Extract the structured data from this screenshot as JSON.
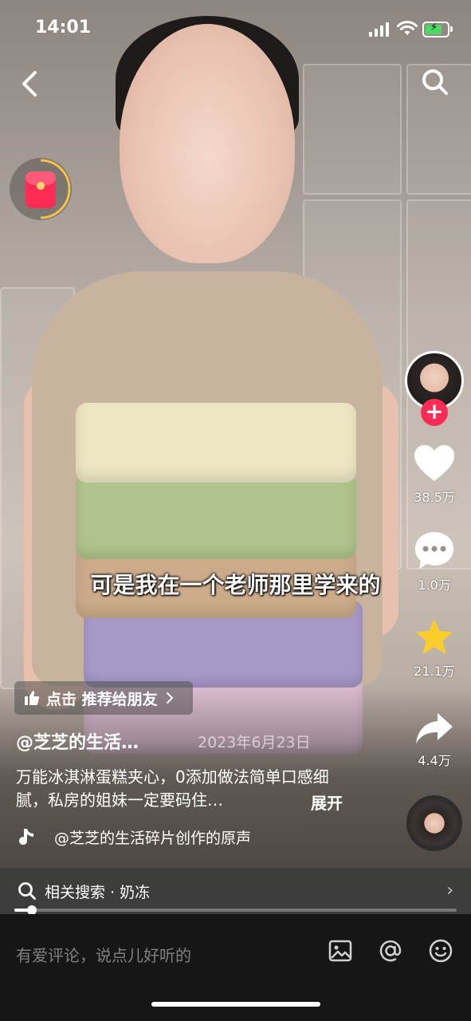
{
  "status_bar": {
    "time": "14:01"
  },
  "subtitle": "可是我在一个老师那里学来的",
  "rail": {
    "like_count": "38.5万",
    "comment_count": "1.0万",
    "favorite_count": "21.1万",
    "share_count": "4.4万"
  },
  "recommend": {
    "label": "点击 推荐给朋友"
  },
  "post": {
    "author": "@芝芝的生活…",
    "date": "2023年6月23日",
    "description": "万能冰淇淋蛋糕夹心，0添加做法简单口感细腻，私房的姐妹一定要码住…",
    "expand_label": "展开",
    "music": "@芝芝的生活碎片创作的原声"
  },
  "related_search": {
    "label": "相关搜索 · 奶冻"
  },
  "progress": {
    "fraction": 0.04
  },
  "comment_bar": {
    "placeholder": "有爱评论，说点儿好听的"
  },
  "icons": [
    "back-icon",
    "search-icon",
    "red-packet-icon",
    "heart-icon",
    "comment-icon",
    "star-icon",
    "share-icon",
    "image-icon",
    "at-icon",
    "emoji-icon",
    "music-note-icon",
    "thumb-up-icon"
  ],
  "colors": {
    "accent": "#fe2c55",
    "favorite": "#facd2a",
    "bottom_bar": "#161616"
  }
}
